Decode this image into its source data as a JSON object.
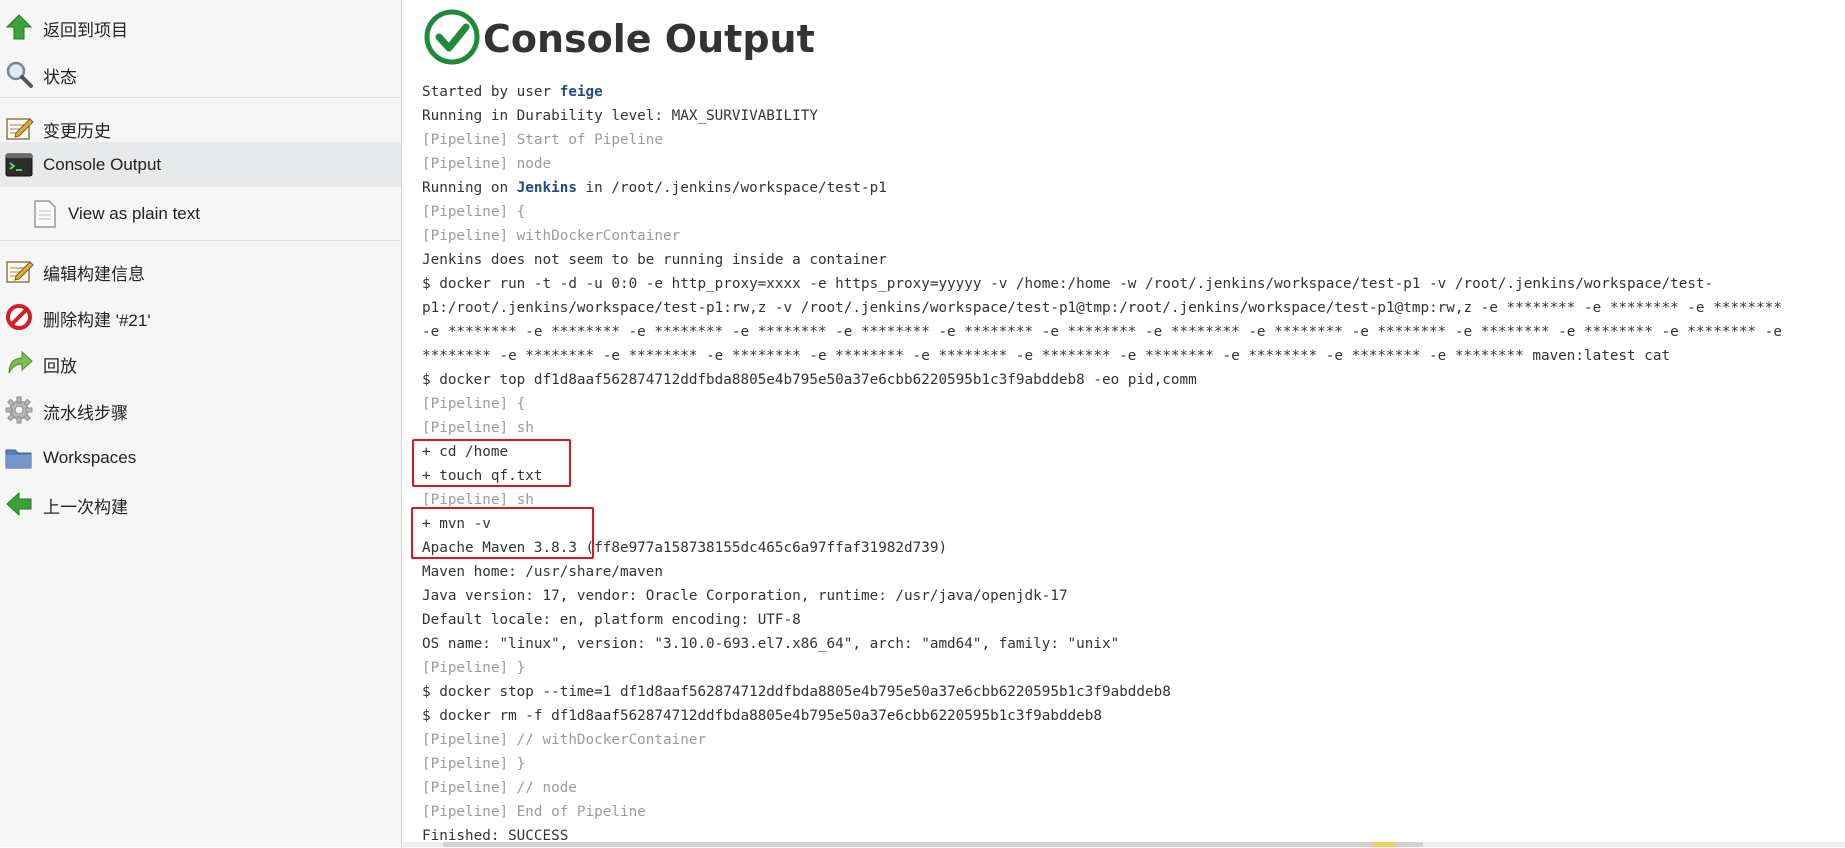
{
  "sidebar": {
    "items": [
      {
        "label": "返回到项目",
        "icon": "arrow-up-icon"
      },
      {
        "label": "状态",
        "icon": "magnifier-icon"
      },
      {
        "label": "变更历史",
        "icon": "notepad-icon"
      },
      {
        "label": "Console Output",
        "icon": "terminal-icon"
      },
      {
        "label": "View as plain text",
        "icon": "document-icon"
      },
      {
        "label": "编辑构建信息",
        "icon": "notepad-icon"
      },
      {
        "label": "删除构建 '#21'",
        "icon": "no-entry-icon"
      },
      {
        "label": "回放",
        "icon": "redo-arrow-icon"
      },
      {
        "label": "流水线步骤",
        "icon": "gear-icon"
      },
      {
        "label": "Workspaces",
        "icon": "folder-icon"
      },
      {
        "label": "上一次构建",
        "icon": "arrow-left-icon"
      }
    ]
  },
  "main": {
    "title": "Console Output",
    "status_icon": "success-check-icon",
    "lines": [
      {
        "text": "Started by user ",
        "link": "feige"
      },
      {
        "text": "Running in Durability level: MAX_SURVIVABILITY"
      },
      {
        "text": "[Pipeline] Start of Pipeline",
        "pipe": true
      },
      {
        "text": "[Pipeline] node",
        "pipe": true
      },
      {
        "text": "Running on ",
        "link": "Jenkins",
        "after": " in /root/.jenkins/workspace/test-p1"
      },
      {
        "text": "[Pipeline] {",
        "pipe": true
      },
      {
        "text": "[Pipeline] withDockerContainer",
        "pipe": true
      },
      {
        "text": "Jenkins does not seem to be running inside a container"
      },
      {
        "text": "$ docker run -t -d -u 0:0 -e http_proxy=xxxx -e https_proxy=yyyyy -v /home:/home -w /root/.jenkins/workspace/test-p1 -v /root/.jenkins/workspace/test-"
      },
      {
        "text": "p1:/root/.jenkins/workspace/test-p1:rw,z -v /root/.jenkins/workspace/test-p1@tmp:/root/.jenkins/workspace/test-p1@tmp:rw,z -e ******** -e ******** -e ********"
      },
      {
        "text": "-e ******** -e ******** -e ******** -e ******** -e ******** -e ******** -e ******** -e ******** -e ******** -e ******** -e ******** -e ******** -e ******** -e"
      },
      {
        "text": "******** -e ******** -e ******** -e ******** -e ******** -e ******** -e ******** -e ******** -e ******** -e ******** -e ******** maven:latest cat"
      },
      {
        "text": "$ docker top df1d8aaf562874712ddfbda8805e4b795e50a37e6cbb6220595b1c3f9abddeb8 -eo pid,comm"
      },
      {
        "text": "[Pipeline] {",
        "pipe": true
      },
      {
        "text": "[Pipeline] sh",
        "pipe": true
      },
      {
        "text": "+ cd /home"
      },
      {
        "text": "+ touch qf.txt"
      },
      {
        "text": "[Pipeline] sh",
        "pipe": true
      },
      {
        "text": "+ mvn -v"
      },
      {
        "text": "Apache Maven 3.8.3 (ff8e977a158738155dc465c6a97ffaf31982d739)"
      },
      {
        "text": "Maven home: /usr/share/maven"
      },
      {
        "text": "Java version: 17, vendor: Oracle Corporation, runtime: /usr/java/openjdk-17"
      },
      {
        "text": "Default locale: en, platform encoding: UTF-8"
      },
      {
        "text": "OS name: \"linux\", version: \"3.10.0-693.el7.x86_64\", arch: \"amd64\", family: \"unix\""
      },
      {
        "text": "[Pipeline] }",
        "pipe": true
      },
      {
        "text": "$ docker stop --time=1 df1d8aaf562874712ddfbda8805e4b795e50a37e6cbb6220595b1c3f9abddeb8"
      },
      {
        "text": "$ docker rm -f df1d8aaf562874712ddfbda8805e4b795e50a37e6cbb6220595b1c3f9abddeb8"
      },
      {
        "text": "[Pipeline] // withDockerContainer",
        "pipe": true
      },
      {
        "text": "[Pipeline] }",
        "pipe": true
      },
      {
        "text": "[Pipeline] // node",
        "pipe": true
      },
      {
        "text": "[Pipeline] End of Pipeline",
        "pipe": true
      },
      {
        "text": "Finished: SUCCESS"
      }
    ]
  },
  "colors": {
    "accent_red": "#e0161b",
    "success_green": "#1e8a3a",
    "link_blue": "#204a87",
    "pipeline_gray": "#9b9b9b"
  }
}
